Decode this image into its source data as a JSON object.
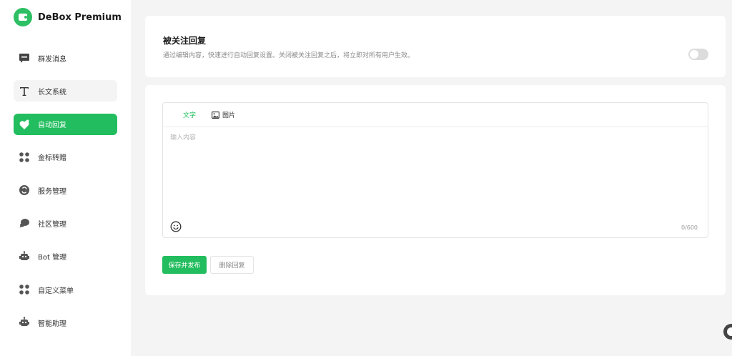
{
  "brand": {
    "name": "DeBox Premium",
    "logo_icon": "wallet-icon",
    "color": "#2dbf63"
  },
  "sidebar": {
    "items": [
      {
        "label": "群发消息",
        "icon": "message-icon",
        "state": "default"
      },
      {
        "label": "长文系统",
        "icon": "text-icon",
        "state": "hover"
      },
      {
        "label": "自动回复",
        "icon": "auto-reply-icon",
        "state": "active"
      },
      {
        "label": "金标转赠",
        "icon": "grid-icon",
        "state": "default"
      },
      {
        "label": "服务管理",
        "icon": "service-icon",
        "state": "default"
      },
      {
        "label": "社区管理",
        "icon": "chat-bubbles-icon",
        "state": "default"
      },
      {
        "label": "Bot 管理",
        "icon": "bot-icon",
        "state": "default"
      },
      {
        "label": "自定义菜单",
        "icon": "grid-icon",
        "state": "default"
      },
      {
        "label": "智能助理",
        "icon": "bot-icon",
        "state": "default"
      }
    ]
  },
  "follow_reply": {
    "title": "被关注回复",
    "description": "通过编辑内容，快速进行自动回复设置。关闭被关注回复之后，将立即对所有用户生效。",
    "enabled": false
  },
  "editor": {
    "tabs": [
      {
        "label": "文字",
        "active": true
      },
      {
        "label": "图片",
        "active": false,
        "icon": "image-icon"
      }
    ],
    "placeholder": "输入内容",
    "counter": "0/600",
    "emoji_icon": "smiley-icon"
  },
  "actions": {
    "save_label": "保存并发布",
    "delete_label": "删除回复"
  },
  "colors": {
    "accent": "#22bd5e",
    "background": "#f4f4f5"
  }
}
